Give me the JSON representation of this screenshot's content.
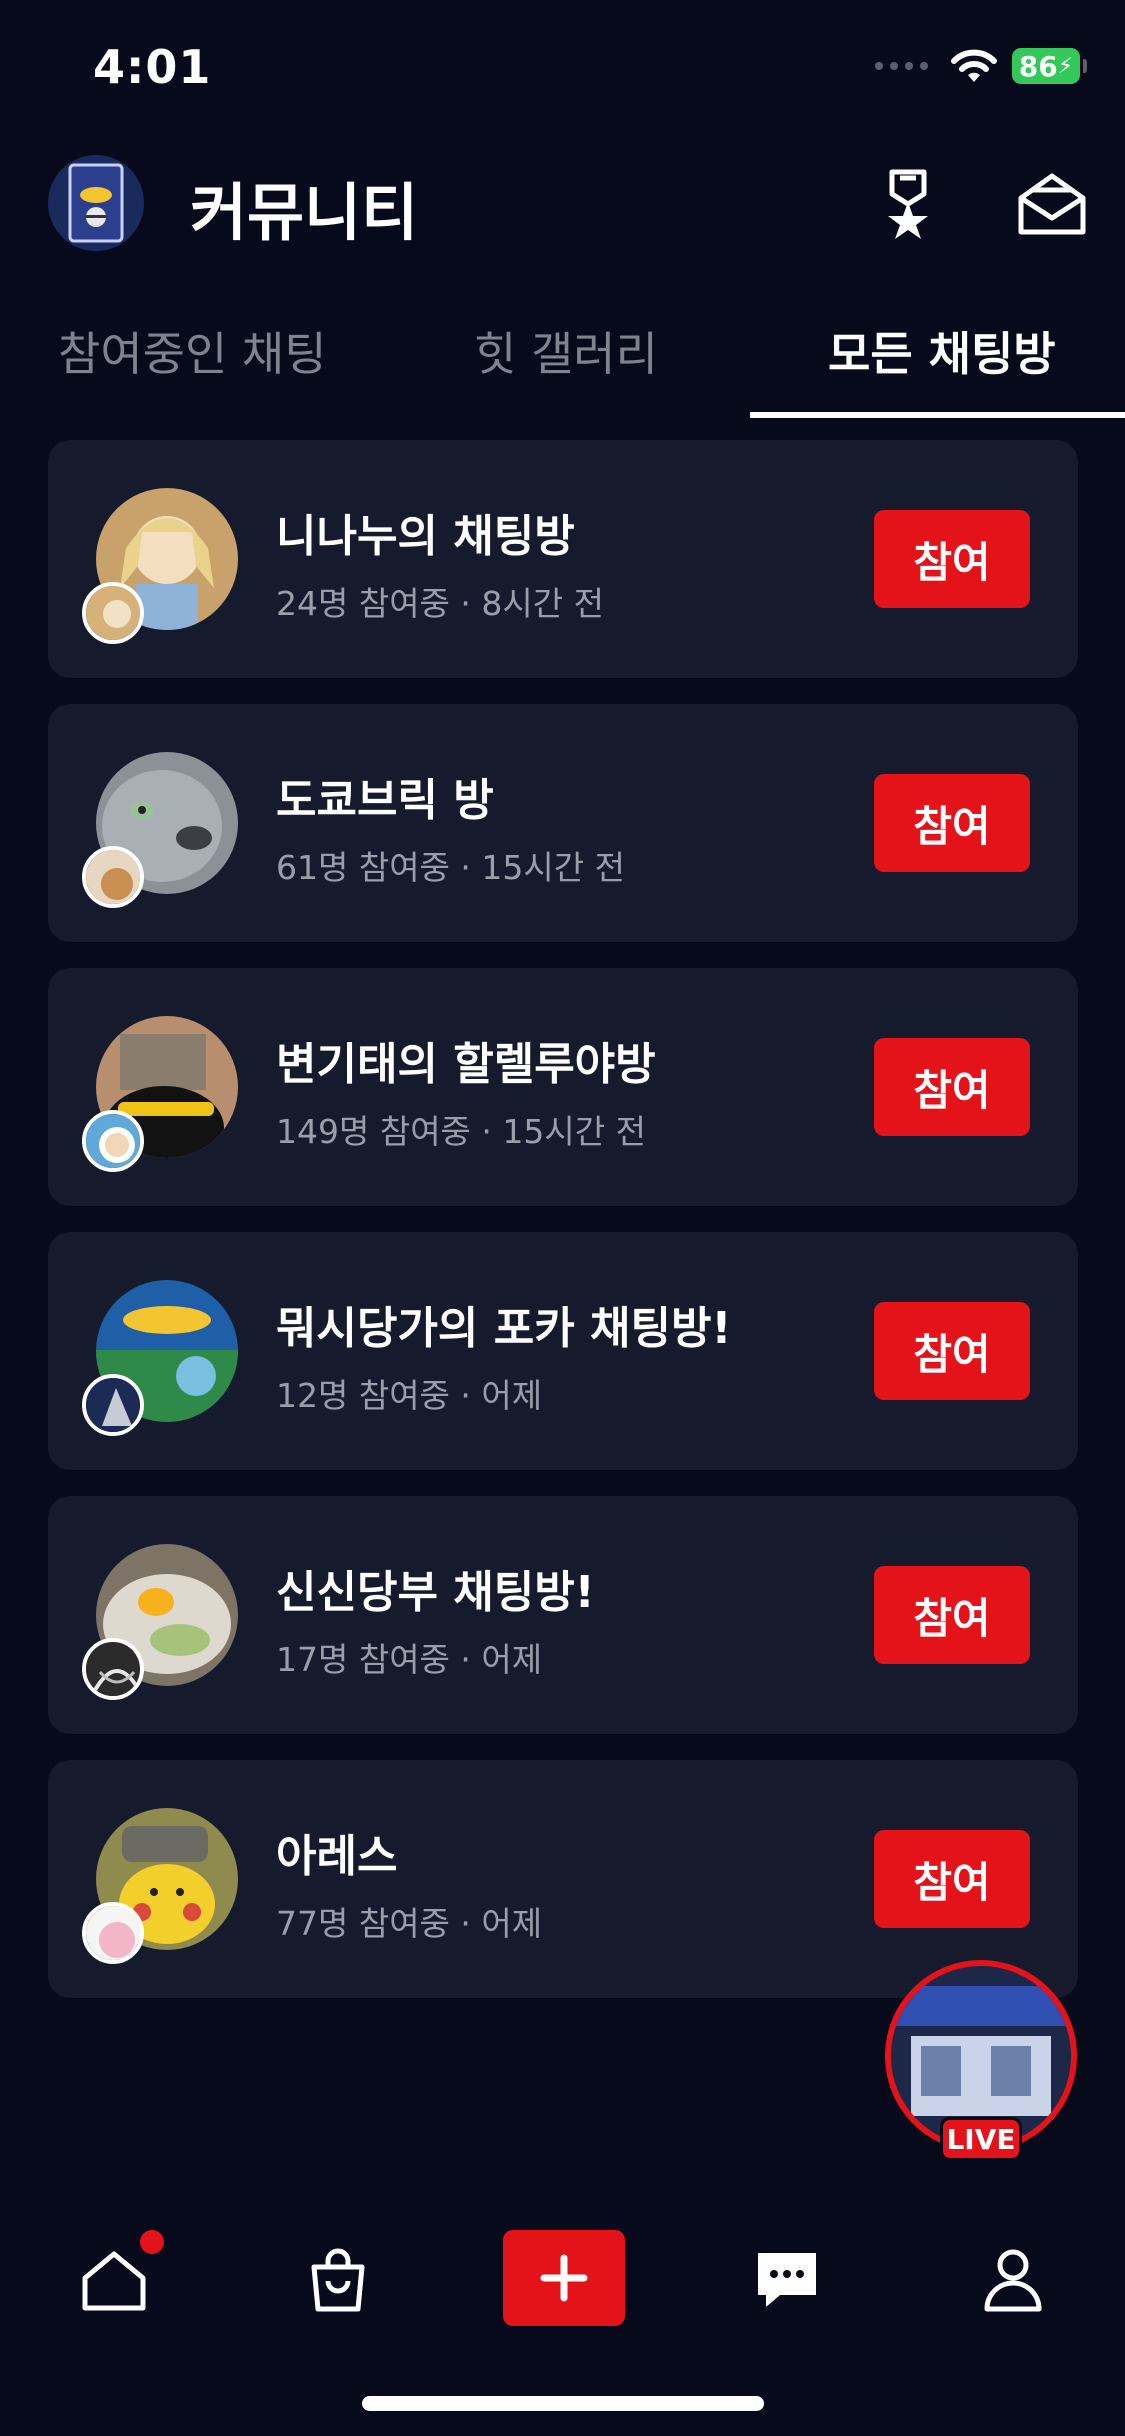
{
  "status_bar": {
    "time": "4:01",
    "battery": "86"
  },
  "header": {
    "title": "커뮤니티",
    "avatar_icon": "pokemon-card-avatar",
    "ranking_icon": "medal-icon",
    "inbox_icon": "mail-open-icon"
  },
  "tabs": [
    {
      "label": "참여중인 채팅",
      "active": false
    },
    {
      "label": "힛 갤러리",
      "active": false
    },
    {
      "label": "모든 채팅방",
      "active": true
    }
  ],
  "rooms": [
    {
      "name": "니나누의 채팅방",
      "meta": "24명 참여중 · 8시간 전",
      "join_label": "참여"
    },
    {
      "name": "도쿄브릭 방",
      "meta": "61명 참여중 · 15시간 전",
      "join_label": "참여"
    },
    {
      "name": "변기태의 할렐루야방",
      "meta": "149명 참여중 · 15시간 전",
      "join_label": "참여"
    },
    {
      "name": "뭐시당가의 포카 채팅방!",
      "meta": "12명 참여중 · 어제",
      "join_label": "참여"
    },
    {
      "name": "신신당부 채팅방!",
      "meta": "17명 참여중 · 어제",
      "join_label": "참여"
    },
    {
      "name": "아레스",
      "meta": "77명 참여중 · 어제",
      "join_label": "참여"
    }
  ],
  "live": {
    "badge": "LIVE"
  },
  "bottom_nav": {
    "items": [
      "home-icon",
      "shopping-bag-icon",
      "plus-icon",
      "chat-bubble-icon",
      "profile-icon"
    ]
  },
  "colors": {
    "accent": "#e4131a",
    "background": "#060a1a",
    "card": "#161a2d",
    "muted": "#9b9ea8"
  }
}
